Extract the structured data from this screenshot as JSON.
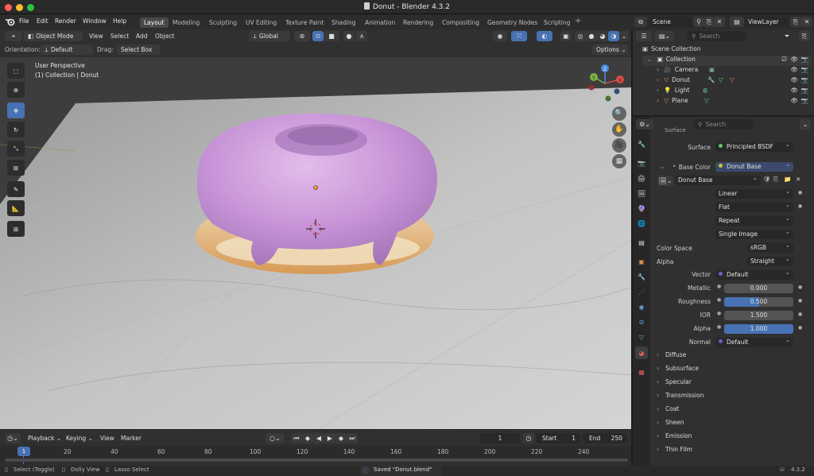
{
  "window": {
    "title": "Donut - Blender 4.3.2",
    "traffic_colors": [
      "#ff5f57",
      "#febc2e",
      "#28c840"
    ]
  },
  "menu": {
    "items": [
      "File",
      "Edit",
      "Render",
      "Window",
      "Help"
    ]
  },
  "workspace_tabs": [
    "Layout",
    "Modeling",
    "Sculpting",
    "UV Editing",
    "Texture Paint",
    "Shading",
    "Animation",
    "Rendering",
    "Compositing",
    "Geometry Nodes",
    "Scripting"
  ],
  "workspace_active": "Layout",
  "scene": {
    "label": "Scene",
    "view_layer": "ViewLayer"
  },
  "viewport_header": {
    "mode": "Object Mode",
    "menus": [
      "View",
      "Select",
      "Add",
      "Object"
    ],
    "transform_orientation": "Global",
    "orientation_label": "Orientation:",
    "orientation_value": "Default",
    "drag_label": "Drag:",
    "drag_value": "Select Box",
    "options": "Options"
  },
  "viewport": {
    "overlay_line1": "User Perspective",
    "overlay_line2": "(1) Collection | Donut",
    "gizmo_labels": {
      "x": "X",
      "y": "Y",
      "z": "Z"
    }
  },
  "outliner": {
    "search_placeholder": "Search",
    "root": "Scene Collection",
    "collection": "Collection",
    "objects": [
      {
        "name": "Camera",
        "icon": "camera-icon"
      },
      {
        "name": "Donut",
        "icon": "mesh-icon"
      },
      {
        "name": "Light",
        "icon": "light-icon"
      },
      {
        "name": "Plane",
        "icon": "mesh-icon"
      }
    ]
  },
  "properties": {
    "search_placeholder": "Search",
    "cut_header": "Surface",
    "surface_label": "Surface",
    "surface_value": "Principled BSDF",
    "base_color_label": "Base Color",
    "base_color_value": "Donut Base",
    "image_name": "Donut Base",
    "interpolation": "Linear",
    "projection": "Flat",
    "extension": "Repeat",
    "source": "Single Image",
    "color_space_label": "Color Space",
    "color_space_value": "sRGB",
    "alpha_mode_label": "Alpha",
    "alpha_mode_value": "Straight",
    "vector_label": "Vector",
    "vector_value": "Default",
    "metallic_label": "Metallic",
    "metallic_value": "0.000",
    "roughness_label": "Roughness",
    "roughness_value": "0.500",
    "roughness_fill": 0.5,
    "ior_label": "IOR",
    "ior_value": "1.500",
    "alpha_label": "Alpha",
    "alpha_value": "1.000",
    "alpha_fill": 1.0,
    "normal_label": "Normal",
    "normal_value": "Default",
    "sections": [
      "Diffuse",
      "Subsurface",
      "Specular",
      "Transmission",
      "Coat",
      "Sheen",
      "Emission",
      "Thin Film"
    ]
  },
  "timeline": {
    "menus": [
      "Playback",
      "Keying",
      "View",
      "Marker"
    ],
    "current_frame": "1",
    "start_label": "Start",
    "start_value": "1",
    "end_label": "End",
    "end_value": "250",
    "ruler": [
      "1",
      "20",
      "40",
      "60",
      "80",
      "100",
      "120",
      "140",
      "160",
      "180",
      "200",
      "220",
      "240"
    ],
    "playhead_frame": "1"
  },
  "status": {
    "select": "Select (Toggle)",
    "dolly": "Dolly View",
    "lasso": "Lasso Select",
    "message": "Saved \"Donut.blend\"",
    "version": "4.3.2"
  },
  "colors": {
    "accent": "#4772b3",
    "active_tab": "#484848",
    "donut_icing": "#c89ad6",
    "donut_base": "#e8b77a",
    "socket_yellow": "#c7c729",
    "socket_purple": "#6363c7",
    "socket_grey": "#a1a1a1",
    "socket_green": "#63c763"
  }
}
